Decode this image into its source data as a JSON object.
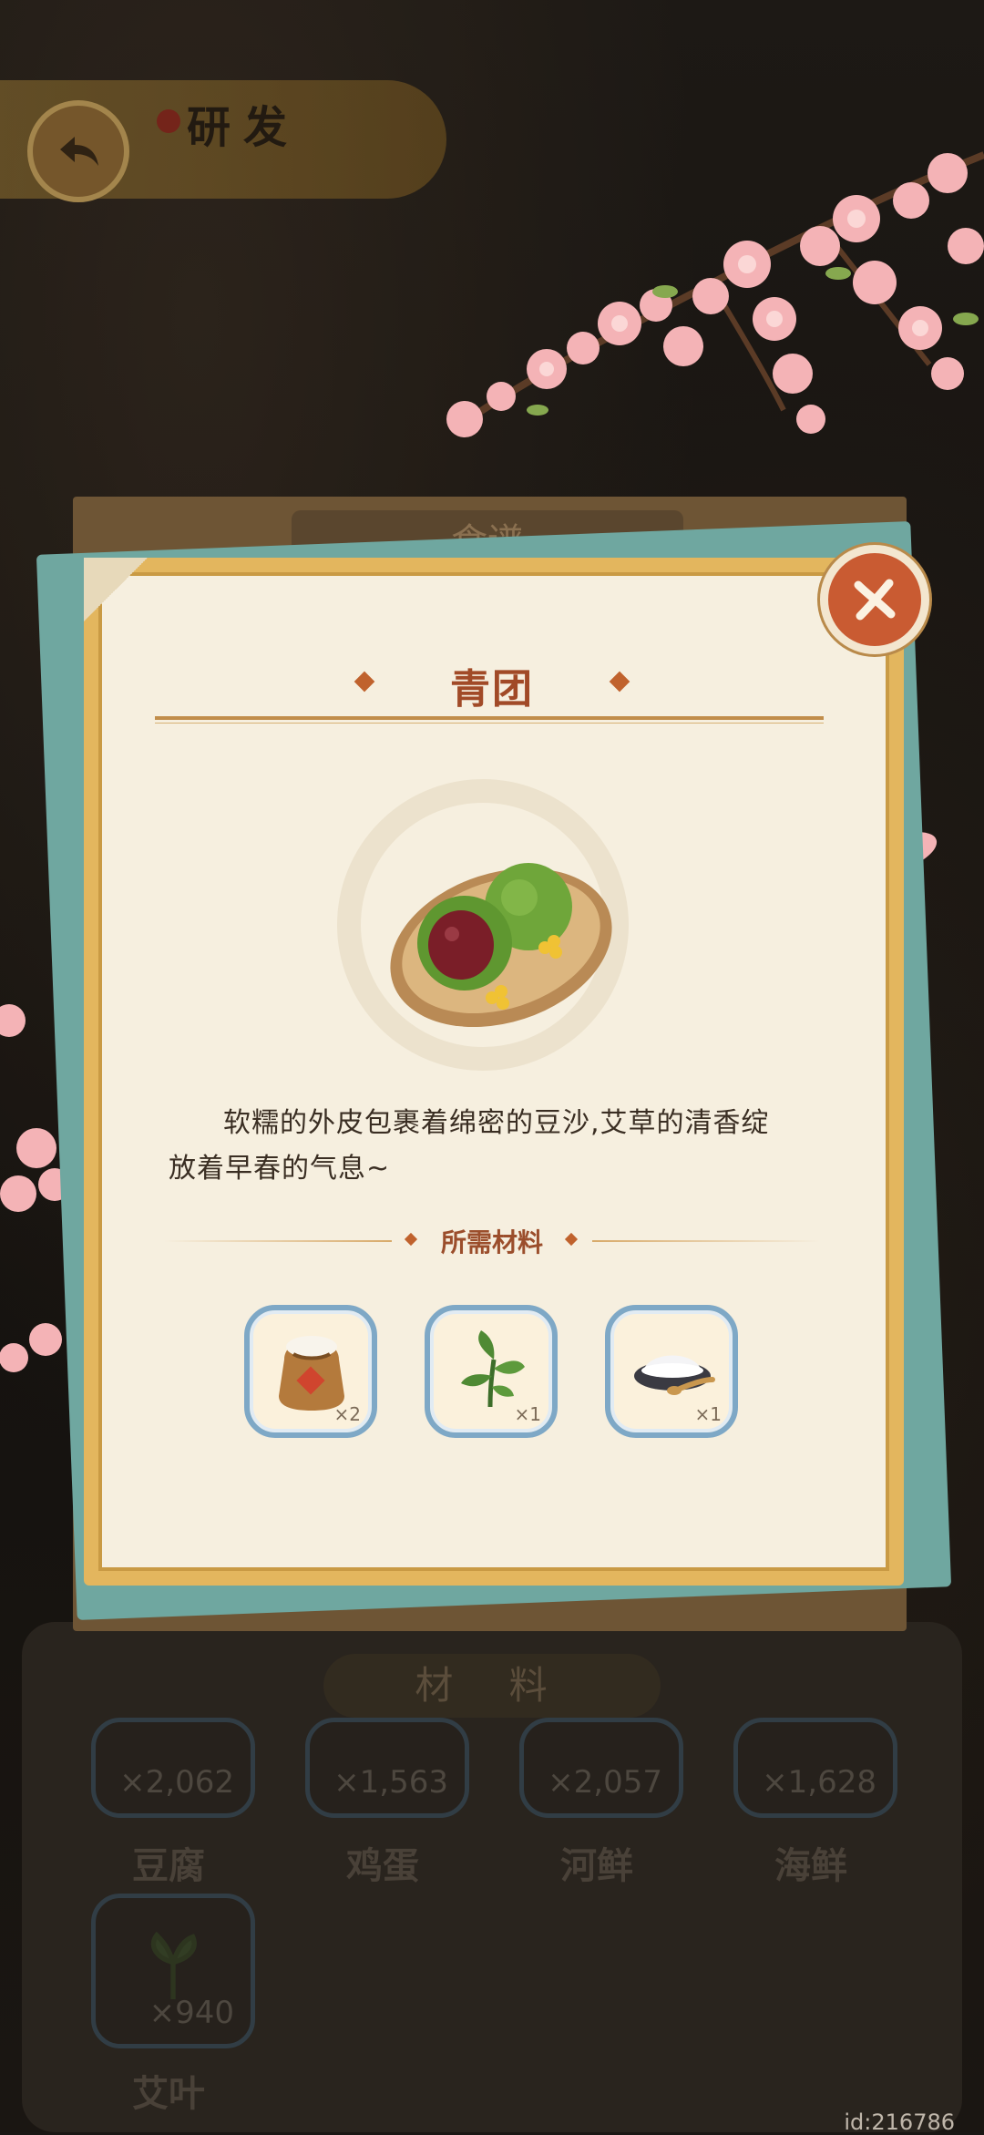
{
  "header": {
    "title": "研发"
  },
  "recipe_card": {
    "header_label": "食谱",
    "dish_name": "青团",
    "description": "软糯的外皮包裹着绵密的豆沙,艾草的清香绽放着早春的气息~",
    "ingredients_heading": "所需材料",
    "ingredients": [
      {
        "icon": "flour-sack-icon",
        "count": "×2"
      },
      {
        "icon": "herb-leaf-icon",
        "count": "×1"
      },
      {
        "icon": "sugar-bowl-icon",
        "count": "×1"
      }
    ]
  },
  "materials_panel": {
    "title": "材 料",
    "items": [
      {
        "name": "豆腐",
        "count": "×2,062"
      },
      {
        "name": "鸡蛋",
        "count": "×1,563"
      },
      {
        "name": "河鲜",
        "count": "×2,057"
      },
      {
        "name": "海鲜",
        "count": "×1,628"
      },
      {
        "name": "艾叶",
        "count": "×940"
      }
    ]
  },
  "footer": {
    "user_id": "id:216786"
  },
  "colors": {
    "accent": "#c95b32",
    "title": "#a14a27",
    "frame": "#e3b65e",
    "slot_border": "#7ea8c6"
  }
}
